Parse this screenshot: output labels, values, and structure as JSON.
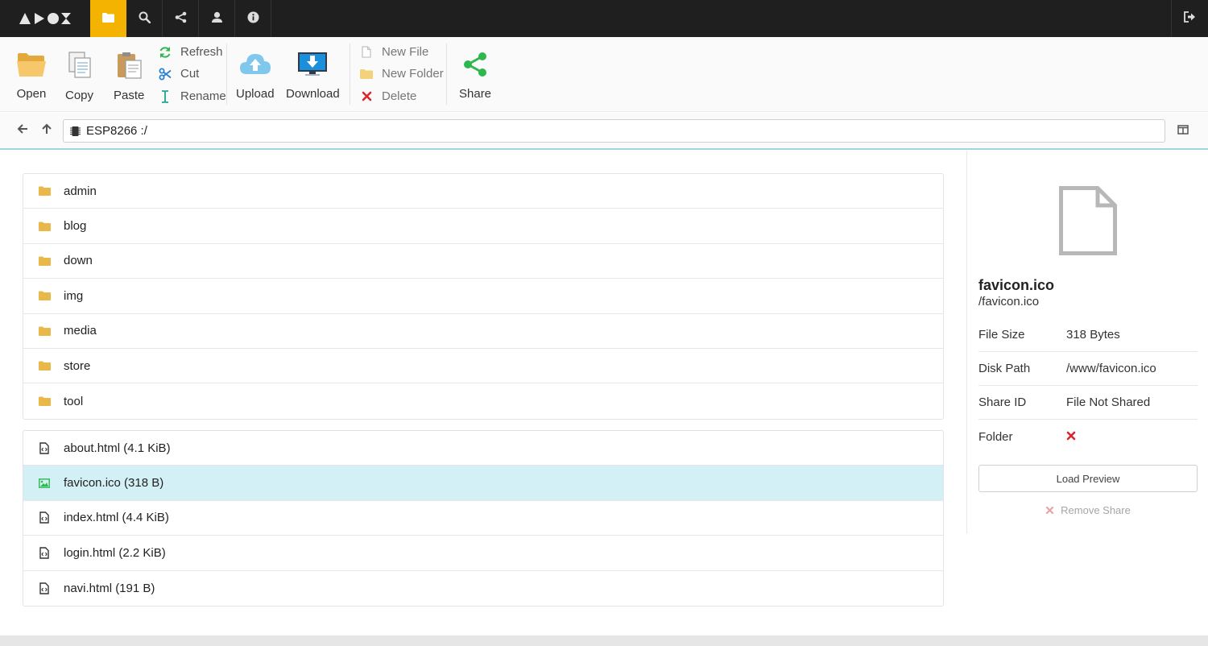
{
  "app": {
    "name": "APOX"
  },
  "topnav": {
    "tabs": [
      {
        "icon": "folder-icon",
        "active": true
      },
      {
        "icon": "search-icon",
        "active": false
      },
      {
        "icon": "share-icon",
        "active": false
      },
      {
        "icon": "user-icon",
        "active": false
      },
      {
        "icon": "info-icon",
        "active": false
      }
    ],
    "logout_icon": "logout-icon",
    "accent_color": "#f5b301"
  },
  "toolbar": {
    "open": "Open",
    "copy": "Copy",
    "paste": "Paste",
    "refresh": "Refresh",
    "cut": "Cut",
    "rename": "Rename",
    "upload": "Upload",
    "download": "Download",
    "new_file": "New File",
    "new_folder": "New Folder",
    "delete": "Delete",
    "share": "Share"
  },
  "pathbar": {
    "path": "ESP8266 :/",
    "device_icon": "chip-icon"
  },
  "folders": [
    {
      "name": "admin"
    },
    {
      "name": "blog"
    },
    {
      "name": "down"
    },
    {
      "name": "img"
    },
    {
      "name": "media"
    },
    {
      "name": "store"
    },
    {
      "name": "tool"
    }
  ],
  "files": [
    {
      "label": "about.html (4.1 KiB)",
      "icon": "code-file-icon",
      "selected": false
    },
    {
      "label": "favicon.ico (318 B)",
      "icon": "image-file-icon",
      "selected": true
    },
    {
      "label": "index.html (4.4 KiB)",
      "icon": "code-file-icon",
      "selected": false
    },
    {
      "label": "login.html (2.2 KiB)",
      "icon": "code-file-icon",
      "selected": false
    },
    {
      "label": "navi.html (191 B)",
      "icon": "code-file-icon",
      "selected": false
    }
  ],
  "detail": {
    "name": "favicon.ico",
    "path": "/favicon.ico",
    "rows": [
      {
        "key": "File Size",
        "value": "318 Bytes"
      },
      {
        "key": "Disk Path",
        "value": "/www/favicon.ico"
      },
      {
        "key": "Share ID",
        "value": "File Not Shared"
      },
      {
        "key": "Folder",
        "value": ""
      }
    ],
    "folder_flag": false,
    "load_preview": "Load Preview",
    "remove_share": "Remove Share"
  },
  "colors": {
    "selected_row": "#d2f0f5",
    "folder": "#e8b84a",
    "share_green": "#2db84d",
    "delete_red": "#d9262f"
  }
}
